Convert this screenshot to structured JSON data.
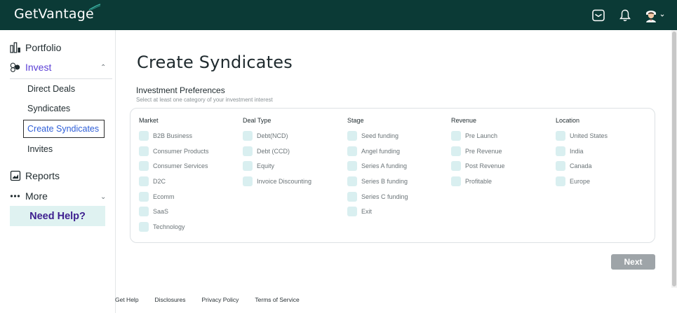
{
  "header": {
    "logo": "GetVantage",
    "icons": [
      "mail-icon",
      "bell-icon",
      "avatar"
    ]
  },
  "sidebar": {
    "portfolio": "Portfolio",
    "invest": "Invest",
    "invest_items": [
      "Direct Deals",
      "Syndicates",
      "Create Syndicates",
      "Invites"
    ],
    "active_item": "Create Syndicates",
    "reports": "Reports",
    "more": "More",
    "help": "Need Help?"
  },
  "main": {
    "title": "Create Syndicates",
    "section_title": "Investment Preferences",
    "section_subtitle": "Select at least one category of your investment interest",
    "columns": [
      {
        "heading": "Market",
        "options": [
          "B2B Business",
          "Consumer Products",
          "Consumer Services",
          "D2C",
          "Ecomm",
          "SaaS",
          "Technology"
        ]
      },
      {
        "heading": "Deal Type",
        "options": [
          "Debt(NCD)",
          "Debt (CCD)",
          "Equity",
          "Invoice Discounting"
        ]
      },
      {
        "heading": "Stage",
        "options": [
          "Seed funding",
          "Angel funding",
          "Series A funding",
          "Series B funding",
          "Series C funding",
          "Exit"
        ]
      },
      {
        "heading": "Revenue",
        "options": [
          "Pre Launch",
          "Pre Revenue",
          "Post Revenue",
          "Profitable"
        ]
      },
      {
        "heading": "Location",
        "options": [
          "United States",
          "India",
          "Canada",
          "Europe"
        ]
      }
    ],
    "next_button": "Next"
  },
  "footer": {
    "links": [
      "Get Help",
      "Disclosures",
      "Privacy Policy",
      "Terms of Service"
    ]
  },
  "colors": {
    "header_bg": "#0b3a36",
    "accent_purple": "#5b3fd6",
    "active_link": "#2f5fd8",
    "checkbox_fill": "#d9eff0",
    "help_bg": "#dff2f1",
    "button_disabled": "#9ea4a8"
  }
}
